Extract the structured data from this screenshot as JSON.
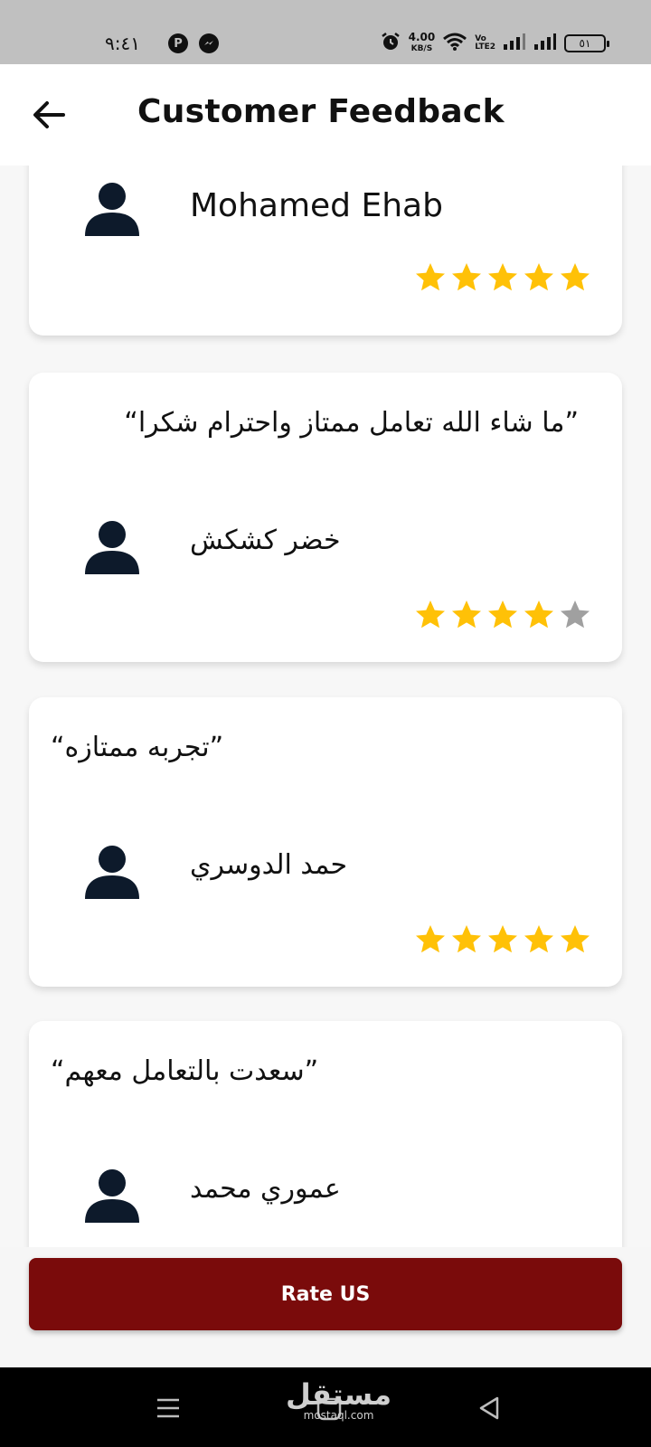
{
  "status_bar": {
    "time": "٩:٤١",
    "left_icons": [
      "pinterest-icon",
      "messenger-icon"
    ],
    "net_speed_value": "4.00",
    "net_speed_unit": "KB/S",
    "volte_top": "Vo",
    "volte_bottom": "LTE2",
    "battery": "٥١"
  },
  "app_bar": {
    "title": "Customer Feedback",
    "back_icon": "arrow-left-icon"
  },
  "feedback": [
    {
      "quote": "",
      "name": "Mohamed Ehab",
      "rating": 5,
      "max_rating": 5
    },
    {
      "quote": "”ما شاء الله تعامل ممتاز واحترام شكرا“",
      "name": "خضر كشكش",
      "rating": 4,
      "max_rating": 5
    },
    {
      "quote": "”تجربه ممتازه“",
      "name": "حمد الدوسري",
      "rating": 5,
      "max_rating": 5
    },
    {
      "quote": "”سعدت بالتعامل معهم“",
      "name": "عموري محمد",
      "rating": null,
      "max_rating": 5
    }
  ],
  "rate_button": {
    "label": "Rate US"
  },
  "nav_bar": {
    "icons": [
      "menu-icon",
      "home-icon",
      "back-triangle-icon"
    ],
    "watermark_ar": "مستقل",
    "watermark_en": "mostaql.com"
  },
  "colors": {
    "star_filled": "#FFC107",
    "star_empty": "#A0A0A0",
    "avatar": "#0D1A2B",
    "button": "#7A0B0B"
  }
}
